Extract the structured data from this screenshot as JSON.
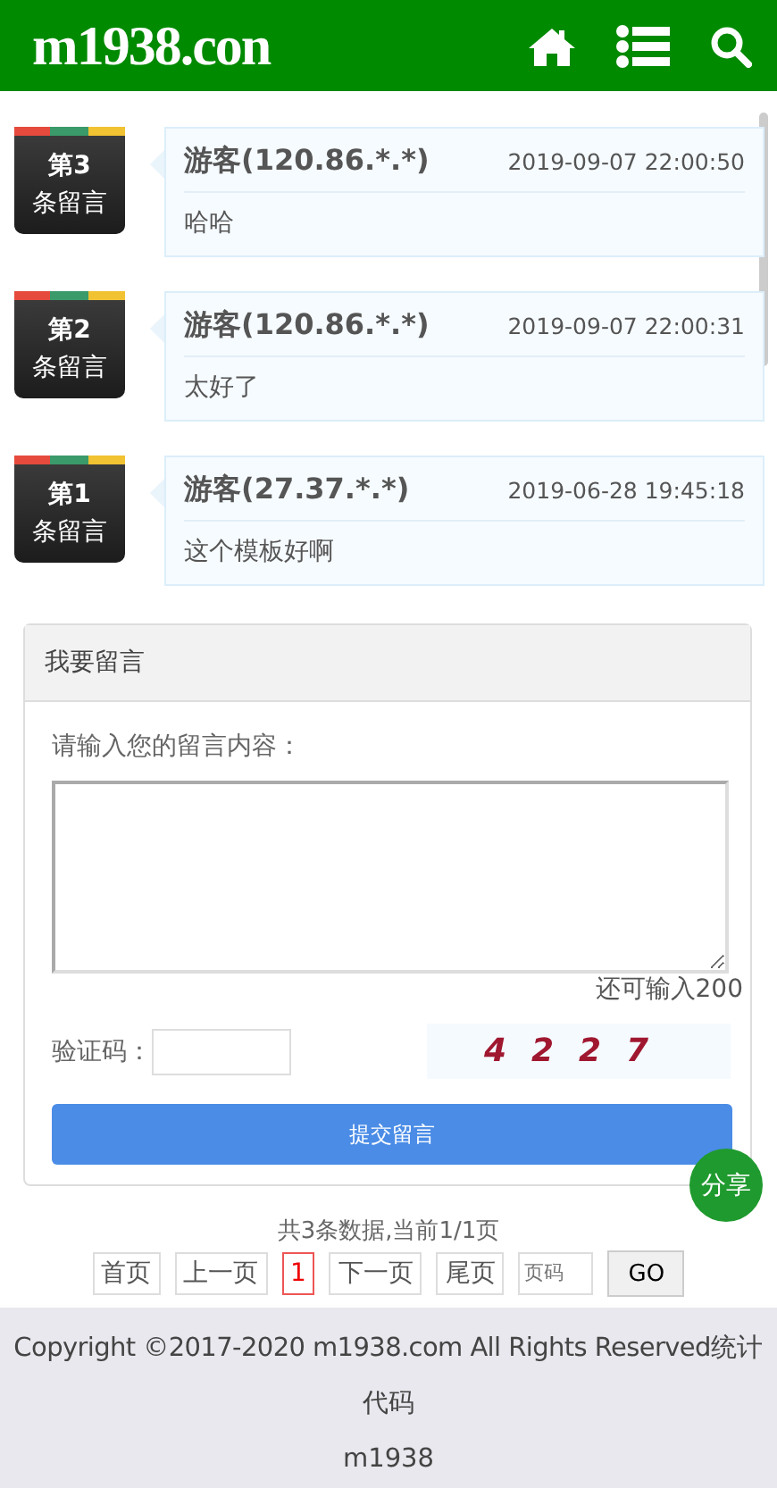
{
  "header": {
    "logo": "m1938.con"
  },
  "comments": [
    {
      "badge_top": "第3",
      "badge_bottom": "条留言",
      "author": "游客(120.86.*.*)",
      "time": "2019-09-07 22:00:50",
      "text": "哈哈"
    },
    {
      "badge_top": "第2",
      "badge_bottom": "条留言",
      "author": "游客(120.86.*.*)",
      "time": "2019-09-07 22:00:31",
      "text": "太好了"
    },
    {
      "badge_top": "第1",
      "badge_bottom": "条留言",
      "author": "游客(27.37.*.*)",
      "time": "2019-06-28 19:45:18",
      "text": "这个模板好啊"
    }
  ],
  "form": {
    "title": "我要留言",
    "prompt": "请输入您的留言内容：",
    "remaining": "还可输入200",
    "captcha_label": "验证码：",
    "captcha": "4227",
    "submit": "提交留言",
    "share": "分享"
  },
  "pager": {
    "summary": "共3条数据,当前1/1页",
    "first": "首页",
    "prev": "上一页",
    "pages": [
      {
        "label": "1",
        "selected": true
      }
    ],
    "next": "下一页",
    "last": "尾页",
    "page_placeholder": "页码",
    "go": "GO"
  },
  "footer": {
    "copyright": "Copyright ©2017-2020 m1938.com All Rights Reserved统计代码",
    "site": "m1938"
  }
}
